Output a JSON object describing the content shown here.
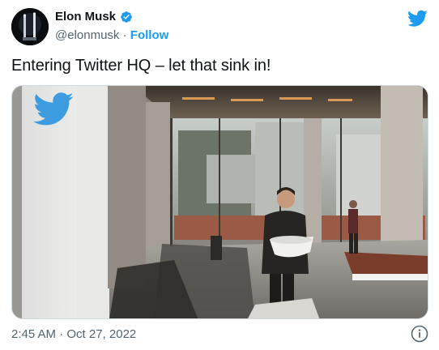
{
  "author": {
    "name": "Elon Musk",
    "handle": "@elonmusk",
    "separator": "·",
    "follow_label": "Follow",
    "verified": true
  },
  "tweet": {
    "text": "Entering Twitter HQ – let that sink in!"
  },
  "meta": {
    "timestamp": "2:45 AM · Oct 27, 2022"
  },
  "icons": {
    "logo": "twitter-bird-icon",
    "verified": "verified-badge-icon",
    "info": "info-icon"
  },
  "colors": {
    "brand_blue": "#1d9bf0",
    "text_primary": "#0f1419",
    "text_secondary": "#536471"
  }
}
